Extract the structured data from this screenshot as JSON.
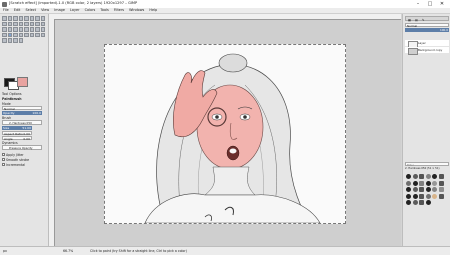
{
  "window": {
    "title": "[Scratch effect] (imported)-1.0 (RGB color, 2 layers) 1920x1297 – GIMP",
    "controls": [
      "–",
      "□",
      "✕"
    ]
  },
  "menubar": [
    "File",
    "Edit",
    "Select",
    "View",
    "Image",
    "Layer",
    "Colors",
    "Tools",
    "Filters",
    "Windows",
    "Help"
  ],
  "tool_options": {
    "title": "Tool Options",
    "tool_name": "Paintbrush",
    "mode_label": "Mode",
    "mode_value": "Normal",
    "opacity_label": "Opacity",
    "opacity_value": "100.0",
    "brush_label": "Brush",
    "brush_value": "2. Hardness 050",
    "size_label": "Size",
    "size_value": "51.00",
    "aspect_label": "Aspect Ratio",
    "aspect_value": "0.00",
    "angle_label": "Angle",
    "angle_value": "0.00",
    "dynamics_label": "Dynamics",
    "dynamics_value": "Pressure Opacity",
    "checks": [
      "Apply Jitter",
      "Smooth stroke",
      "Incremental"
    ]
  },
  "layers": {
    "mode": "Normal",
    "opacity": "100.0",
    "items": [
      "Layer",
      "Background copy"
    ]
  },
  "brushes": {
    "filter": "Filter",
    "current": "2. Hardness 050 (51 × 51)"
  },
  "status": {
    "unit": "px",
    "zoom": "66.7%",
    "message": "Click to paint (try Shift for a straight line, Ctrl to pick a color)"
  }
}
